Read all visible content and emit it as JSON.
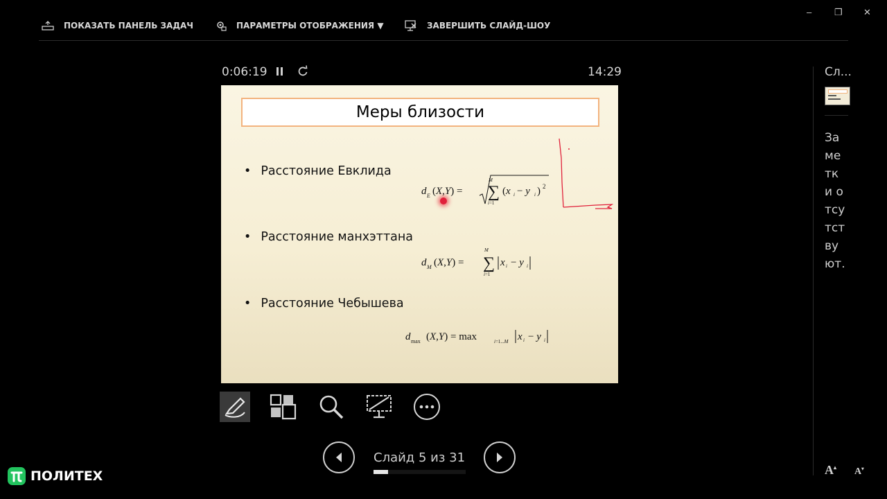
{
  "toolbar": {
    "show_taskbar": "ПОКАЗАТЬ ПАНЕЛЬ ЗАДАЧ",
    "display_settings": "ПАРАМЕТРЫ ОТОБРАЖЕНИЯ",
    "display_settings_arrow": "▼",
    "end_show": "ЗАВЕРШИТЬ СЛАЙД-ШОУ"
  },
  "window_controls": {
    "minimize": "–",
    "restore": "❐",
    "close": "✕"
  },
  "presenter": {
    "elapsed_time": "0:06:19",
    "clock": "14:29"
  },
  "slide": {
    "title": "Меры близости",
    "bullets": [
      "Расстояние Евклида",
      "Расстояние манхэттана",
      "Расстояние Чебышева"
    ]
  },
  "navigation": {
    "counter": "Слайд 5 из 31",
    "current": 5,
    "total": 31
  },
  "side_panel": {
    "next_label": "Сл...",
    "notes_text": "Заметки отсутствуют."
  },
  "brand": {
    "name": "ПОЛИТЕХ"
  },
  "colors": {
    "background": "#000000",
    "ink": "#e0203a",
    "title_border": "#f3b37e",
    "slide_bg": "#f8f1dc"
  }
}
